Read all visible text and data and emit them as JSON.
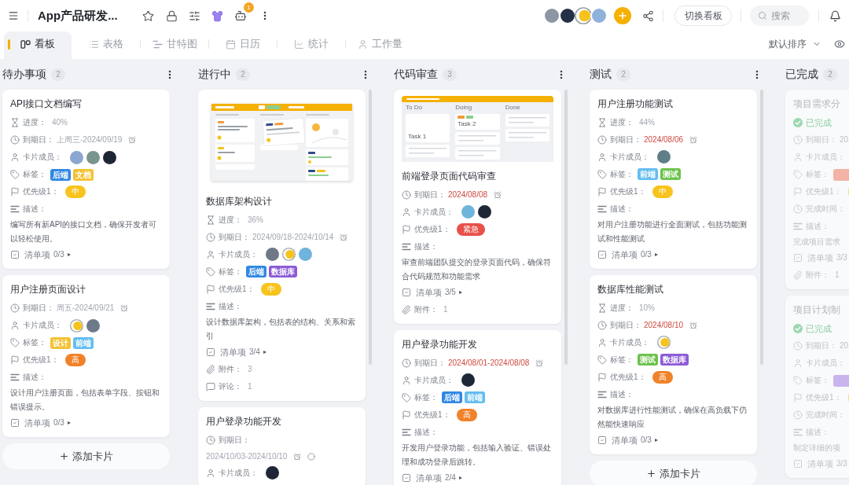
{
  "header": {
    "title": "App产品研发...",
    "notification_count": "1",
    "members": [
      {
        "kind": "photo",
        "color": "#8d96a3"
      },
      {
        "kind": "photo",
        "color": "#243047"
      },
      {
        "kind": "yolk"
      },
      {
        "kind": "photo",
        "color": "#8fb2db"
      }
    ],
    "switch_button": "切换看板",
    "search": {
      "placeholder": "搜索"
    }
  },
  "views": {
    "tabs": [
      {
        "label": "看板",
        "selected": true
      },
      {
        "label": "表格",
        "selected": false
      },
      {
        "label": "甘特图",
        "selected": false
      },
      {
        "label": "日历",
        "selected": false
      },
      {
        "label": "统计",
        "selected": false
      },
      {
        "label": "工作量",
        "selected": false
      }
    ],
    "sort": "默认排序"
  },
  "columns": [
    {
      "title": "待办事项",
      "count": "2",
      "dimmed": false,
      "scrollbar": false,
      "add_card": "添加卡片",
      "cards": [
        {
          "title": "API接口文档编写",
          "fields": [
            {
              "kind": "progress",
              "label": "进度：",
              "value": "40%"
            },
            {
              "kind": "due",
              "label": "到期日：",
              "value": "上周三-2024/09/19",
              "overdue": false,
              "reminder": true
            },
            {
              "kind": "members",
              "label": "卡片成员：",
              "avatars": [
                {
                  "kind": "photo",
                  "color": "#8aa7cf"
                },
                {
                  "kind": "photo",
                  "color": "#7a948f"
                },
                {
                  "kind": "photo",
                  "color": "#1d2434"
                }
              ]
            },
            {
              "kind": "tags",
              "label": "标签：",
              "tags": [
                {
                  "text": "后端",
                  "color": "#2f87e4"
                },
                {
                  "text": "文档",
                  "color": "#f3c233"
                }
              ]
            },
            {
              "kind": "priority",
              "label": "优先级1：",
              "badge": {
                "text": "中",
                "color": "#f7c31d"
              }
            },
            {
              "kind": "description",
              "label": "描述：",
              "text": "编写所有新API的接口文档，确保开发者可以轻松使用。"
            },
            {
              "kind": "checklist",
              "label": "清单项",
              "value": "0/3",
              "arrow": "▸"
            }
          ]
        },
        {
          "title": "用户注册页面设计",
          "fields": [
            {
              "kind": "due",
              "label": "到期日：",
              "value": "周五-2024/09/21",
              "overdue": false,
              "reminder": true
            },
            {
              "kind": "members",
              "label": "卡片成员：",
              "avatars": [
                {
                  "kind": "yolk"
                },
                {
                  "kind": "photo",
                  "color": "#6d7a8c"
                }
              ]
            },
            {
              "kind": "tags",
              "label": "标签：",
              "tags": [
                {
                  "text": "设计",
                  "color": "#f3c233"
                },
                {
                  "text": "前端",
                  "color": "#63bdf0"
                }
              ]
            },
            {
              "kind": "priority",
              "label": "优先级1：",
              "badge": {
                "text": "高",
                "color": "#f0822a"
              }
            },
            {
              "kind": "description",
              "label": "描述：",
              "text": "设计用户注册页面，包括表单字段、按钮和错误提示。"
            },
            {
              "kind": "checklist",
              "label": "清单项",
              "value": "0/3",
              "arrow": "▸"
            }
          ]
        }
      ]
    },
    {
      "title": "进行中",
      "count": "2",
      "dimmed": false,
      "scrollbar": true,
      "cards": [
        {
          "cover": {
            "kind": "app_screenshot"
          },
          "title": "数据库架构设计",
          "fields": [
            {
              "kind": "progress",
              "label": "进度：",
              "value": "36%"
            },
            {
              "kind": "due",
              "label": "到期日：",
              "value": "2024/09/18-2024/10/14",
              "overdue": false,
              "reminder": true
            },
            {
              "kind": "members",
              "label": "卡片成员：",
              "avatars": [
                {
                  "kind": "photo",
                  "color": "#6f7886"
                },
                {
                  "kind": "yolk"
                },
                {
                  "kind": "photo",
                  "color": "#6fb4dc"
                }
              ]
            },
            {
              "kind": "tags",
              "label": "标签：",
              "tags": [
                {
                  "text": "后端",
                  "color": "#2f87e4"
                },
                {
                  "text": "数据库",
                  "color": "#8c5ad6"
                }
              ]
            },
            {
              "kind": "priority",
              "label": "优先级1：",
              "badge": {
                "text": "中",
                "color": "#f7c31d"
              }
            },
            {
              "kind": "description",
              "label": "描述：",
              "text": "设计数据库架构，包括表的结构、关系和索引"
            },
            {
              "kind": "checklist",
              "label": "清单项",
              "value": "3/4",
              "arrow": "▸"
            },
            {
              "kind": "attachments",
              "label": "附件：",
              "value": "3"
            },
            {
              "kind": "comments",
              "label": "评论：",
              "value": "1"
            }
          ]
        },
        {
          "title": "用户登录功能开发",
          "fields": [
            {
              "kind": "due",
              "label": "到期日：",
              "value": "2024/10/03-2024/10/10",
              "overdue": false,
              "reminder": true,
              "done": false
            },
            {
              "kind": "members",
              "label": "卡片成员：",
              "avatars": [
                {
                  "kind": "photo",
                  "color": "#1f2737"
                }
              ]
            }
          ]
        }
      ]
    },
    {
      "title": "代码审查",
      "count": "3",
      "dimmed": false,
      "scrollbar": true,
      "cards": [
        {
          "cover": {
            "kind": "board_sketch",
            "columns": [
              {
                "title": "To Do",
                "cards": [
                  {
                    "kind": "titled",
                    "title": "Task 1"
                  },
                  {
                    "kind": "lines"
                  }
                ]
              },
              {
                "title": "Doing",
                "cards": [
                  {
                    "kind": "titled",
                    "title": "Task 2",
                    "tags": [
                      {
                        "color": "#f29a3a"
                      },
                      {
                        "color": "#8bcf8f"
                      }
                    ]
                  },
                  {
                    "kind": "lines"
                  },
                  {
                    "kind": "lines"
                  }
                ]
              },
              {
                "title": "Done",
                "cards": [
                  {
                    "kind": "lines"
                  },
                  {
                    "kind": "lines"
                  }
                ]
              }
            ]
          },
          "title": "前端登录页面代码审查",
          "fields": [
            {
              "kind": "due",
              "label": "到期日：",
              "value": "2024/08/08",
              "overdue": true,
              "reminder": true
            },
            {
              "kind": "members",
              "label": "卡片成员：",
              "avatars": [
                {
                  "kind": "photo",
                  "color": "#6fb4dc"
                },
                {
                  "kind": "photo",
                  "color": "#1f2737"
                }
              ]
            },
            {
              "kind": "priority",
              "label": "优先级1：",
              "badge": {
                "text": "紧急",
                "color": "#e8504a"
              }
            },
            {
              "kind": "description",
              "label": "描述：",
              "text": "审查前端团队提交的登录页面代码，确保符合代码规范和功能需求"
            },
            {
              "kind": "checklist",
              "label": "清单项",
              "value": "3/5",
              "arrow": "▸"
            },
            {
              "kind": "attachments",
              "label": "附件：",
              "value": "1"
            }
          ]
        },
        {
          "title": "用户登录功能开发",
          "fields": [
            {
              "kind": "due",
              "label": "到期日：",
              "value": "2024/08/01-2024/08/08",
              "overdue": true,
              "reminder": true
            },
            {
              "kind": "members",
              "label": "卡片成员：",
              "avatars": [
                {
                  "kind": "photo",
                  "color": "#1f2737"
                }
              ]
            },
            {
              "kind": "tags",
              "label": "标签：",
              "tags": [
                {
                  "text": "后端",
                  "color": "#2f87e4"
                },
                {
                  "text": "前端",
                  "color": "#63bdf0"
                }
              ]
            },
            {
              "kind": "priority",
              "label": "优先级1：",
              "badge": {
                "text": "高",
                "color": "#f0822a"
              }
            },
            {
              "kind": "description",
              "label": "描述：",
              "text": "开发用户登录功能，包括输入验证、错误处理和成功登录后跳转。"
            },
            {
              "kind": "checklist",
              "label": "清单项",
              "value": "2/4",
              "arrow": "▸"
            }
          ]
        }
      ]
    },
    {
      "title": "测试",
      "count": "2",
      "dimmed": false,
      "scrollbar": true,
      "add_card": "添加卡片",
      "cards": [
        {
          "title": "用户注册功能测试",
          "fields": [
            {
              "kind": "progress",
              "label": "进度：",
              "value": "44%"
            },
            {
              "kind": "due",
              "label": "到期日：",
              "value": "2024/08/06",
              "overdue": true,
              "reminder": true
            },
            {
              "kind": "members",
              "label": "卡片成员：",
              "avatars": [
                {
                  "kind": "photo",
                  "color": "#5e7f86"
                }
              ]
            },
            {
              "kind": "tags",
              "label": "标签：",
              "tags": [
                {
                  "text": "前端",
                  "color": "#63bdf0"
                },
                {
                  "text": "测试",
                  "color": "#6cc24d"
                }
              ]
            },
            {
              "kind": "priority",
              "label": "优先级1：",
              "badge": {
                "text": "中",
                "color": "#f7c31d"
              }
            },
            {
              "kind": "description",
              "label": "描述：",
              "text": "对用户注册功能进行全面测试，包括功能测试和性能测试"
            },
            {
              "kind": "checklist",
              "label": "清单项",
              "value": "0/3",
              "arrow": "▸"
            }
          ]
        },
        {
          "title": "数据库性能测试",
          "fields": [
            {
              "kind": "progress",
              "label": "进度：",
              "value": "10%"
            },
            {
              "kind": "due",
              "label": "到期日：",
              "value": "2024/08/10",
              "overdue": true,
              "reminder": true
            },
            {
              "kind": "members",
              "label": "卡片成员：",
              "avatars": [
                {
                  "kind": "yolk"
                }
              ]
            },
            {
              "kind": "tags",
              "label": "标签：",
              "tags": [
                {
                  "text": "测试",
                  "color": "#6cc24d"
                },
                {
                  "text": "数据库",
                  "color": "#8c5ad6"
                }
              ]
            },
            {
              "kind": "priority",
              "label": "优先级1：",
              "badge": {
                "text": "高",
                "color": "#f0822a"
              }
            },
            {
              "kind": "description",
              "label": "描述：",
              "text": "对数据库进行性能测试，确保在高负载下仍然能快速响应"
            },
            {
              "kind": "checklist",
              "label": "清单项",
              "value": "0/3",
              "arrow": "▸"
            }
          ]
        }
      ]
    },
    {
      "title": "已完成",
      "count": "2",
      "dimmed": true,
      "scrollbar": false,
      "cards": [
        {
          "title": "项目需求分",
          "fields": [
            {
              "kind": "status",
              "label": "已完成"
            },
            {
              "kind": "due",
              "label": "到期日：",
              "value": "20",
              "overdue": false
            },
            {
              "kind": "members",
              "label": "卡片成员："
            },
            {
              "kind": "tags",
              "label": "标签：",
              "tags": [
                {
                  "color": "#f3b3a6"
                }
              ]
            },
            {
              "kind": "priority",
              "label": "优先级1：",
              "badge": {
                "color": "#f9d98c"
              }
            },
            {
              "kind": "completed_at",
              "label": "完成时间："
            },
            {
              "kind": "description",
              "label": "描述：",
              "text": "完成项目需求"
            },
            {
              "kind": "checklist",
              "label": "清单项",
              "value": "3/3"
            },
            {
              "kind": "attachments",
              "label": "附件：",
              "value": "1"
            }
          ]
        },
        {
          "title": "项目计划制",
          "fields": [
            {
              "kind": "status",
              "label": "已完成"
            },
            {
              "kind": "due",
              "label": "到期日：",
              "value": "20",
              "overdue": false
            },
            {
              "kind": "members",
              "label": "卡片成员："
            },
            {
              "kind": "tags",
              "label": "标签：",
              "tags": [
                {
                  "color": "#c9b4ee"
                }
              ]
            },
            {
              "kind": "priority",
              "label": "优先级1：",
              "badge": {
                "color": "#f9d98c"
              }
            },
            {
              "kind": "completed_at",
              "label": "完成时间："
            },
            {
              "kind": "description",
              "label": "描述：",
              "text": "制定详细的项"
            },
            {
              "kind": "checklist",
              "label": "清单项",
              "value": "3/3"
            }
          ]
        }
      ]
    }
  ]
}
